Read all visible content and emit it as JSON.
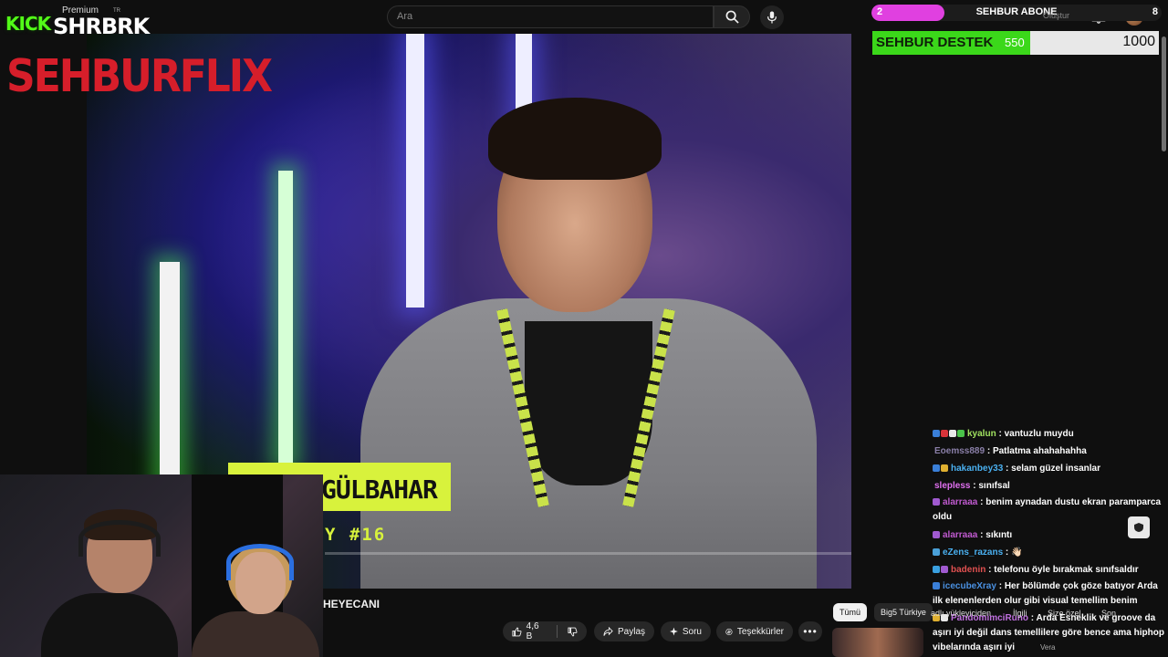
{
  "logo": {
    "kick": "KICK",
    "name": "SHRBRK",
    "premium": "Premium",
    "region": "TR"
  },
  "search": {
    "placeholder": "Ara"
  },
  "video_overlay": {
    "brand": "SEHBURFLIX",
    "nameplate": "GÜLBAHAR",
    "subplate": "Y #16"
  },
  "sub_goal": {
    "current": "2",
    "label": "SEHBUR ABONE",
    "max": "8",
    "progress": 0.25,
    "fill_color": "#e040e0",
    "tooltip": "Oluştur"
  },
  "destek_goal": {
    "label": "SEHBUR DESTEK",
    "current": "550",
    "max": "1000",
    "progress": 0.55,
    "fill_color": "#3bd81a"
  },
  "chat": [
    {
      "user": "kyalun",
      "color": "#a0e060",
      "text": "vantuzlu muydu",
      "badges": [
        "#3a7fd8",
        "#d8343a",
        "#e8e8e8",
        "#4ac24a"
      ]
    },
    {
      "user": "Eoemss889",
      "color": "#8a7fa8",
      "text": "Patlatma ahahahahha",
      "badges": []
    },
    {
      "user": "hakanbey33",
      "color": "#4ab0f0",
      "text": "selam güzel insanlar",
      "badges": [
        "#3a7fd8",
        "#e0b030"
      ]
    },
    {
      "user": "slepless",
      "color": "#e070f0",
      "text": "sınıfsal",
      "badges": []
    },
    {
      "user": "alarraaa",
      "color": "#c05ad0",
      "text": "benim aynadan dustu ekran paramparca oldu",
      "badges": [
        "#a05ad0"
      ]
    },
    {
      "user": "alarraaa",
      "color": "#c05ad0",
      "text": "sıkıntı",
      "badges": [
        "#a05ad0"
      ]
    },
    {
      "user": "eZens_razans",
      "color": "#4ab0f0",
      "text": "👋🏻",
      "badges": [
        "#4aa0d8"
      ]
    },
    {
      "user": "badenin",
      "color": "#e05050",
      "text": "telefonu öyle bırakmak sınıfsaldır",
      "badges": [
        "#3aa0e0",
        "#a05ad0"
      ]
    },
    {
      "user": "icecubeXray",
      "color": "#4a90e0",
      "text": "Her bölümde çok göze batıyor Arda ilk elenenlerden olur gibi visual temellim benim",
      "badges": [
        "#3a7fd8"
      ]
    },
    {
      "user": "PandomimciRuno",
      "color": "#c070e0",
      "text": "Arda Esneklik ve groove da aşırı iyi değil dans temellilere göre bence ama hiphop vibelarında aşırı iyi",
      "badges": [
        "#e0b030",
        "#e8e8e8"
      ]
    }
  ],
  "video": {
    "title": "HEYECANI"
  },
  "actions": {
    "likes": "4,6 B",
    "share": "Paylaş",
    "ask": "Soru",
    "thanks": "Teşekkürler"
  },
  "chips": {
    "all": "Tümü",
    "big5": "Big5 Türkiye",
    "related": "İlgili",
    "for_you": "Size özel",
    "uploader": "adlı yükleyiciden",
    "more": "Son"
  },
  "footer_note": "Vera"
}
